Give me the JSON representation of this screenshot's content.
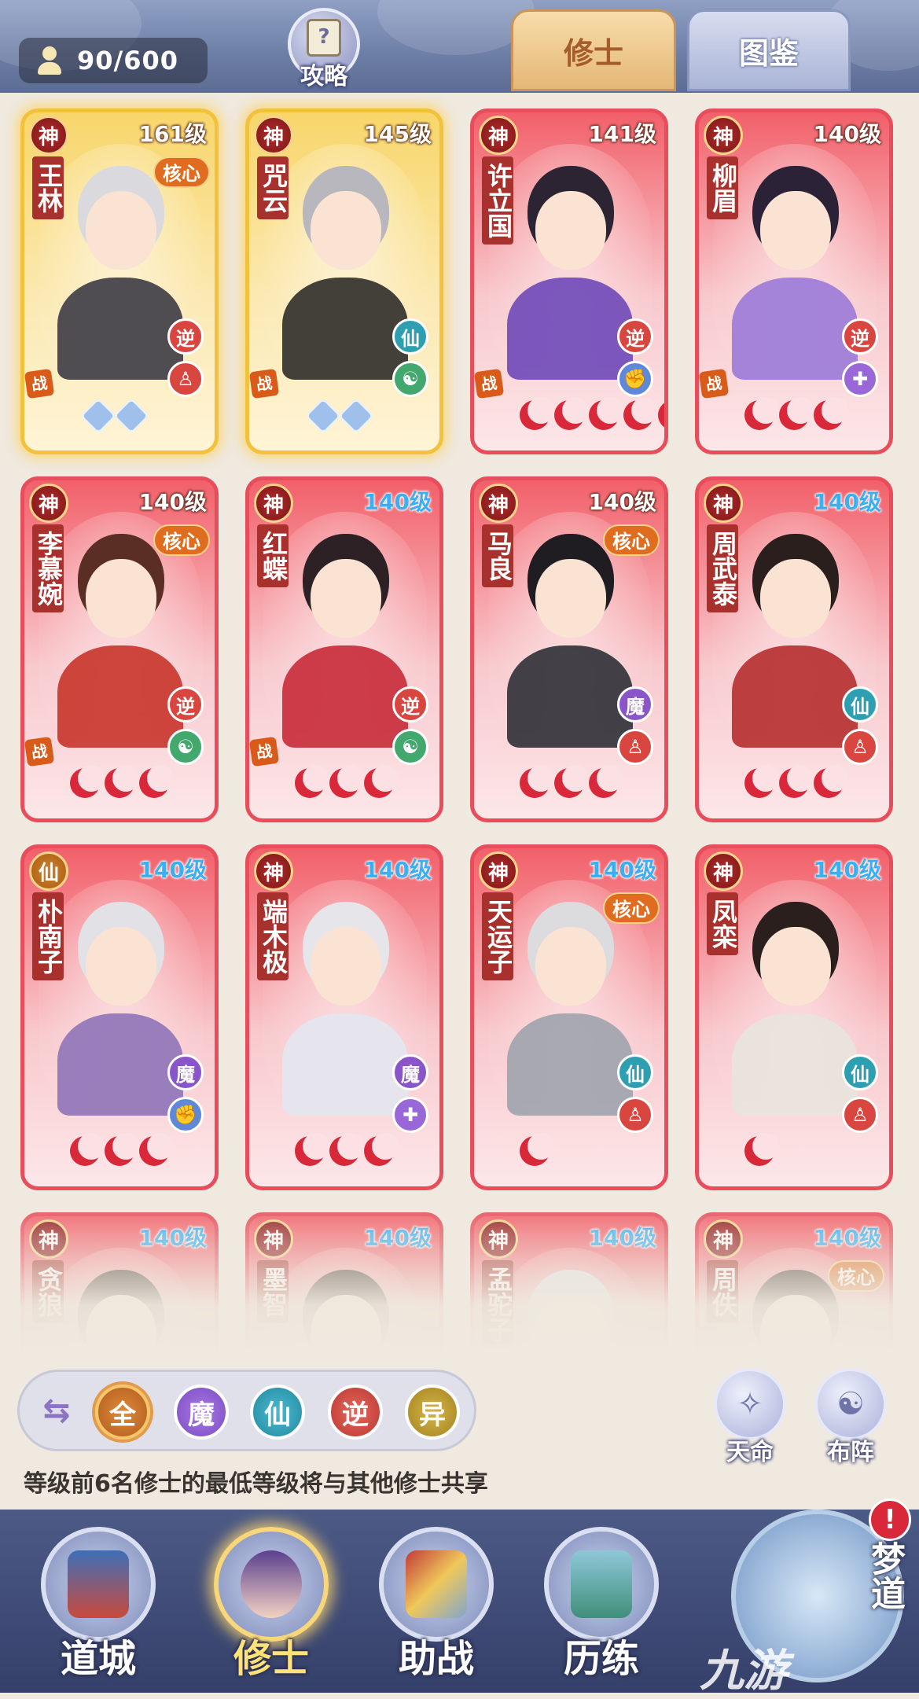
{
  "header": {
    "count": "90/600",
    "guide_label": "攻略",
    "tabs": [
      {
        "label": "修士",
        "active": true
      },
      {
        "label": "图鉴",
        "active": false
      }
    ]
  },
  "cards": [
    {
      "rank": "神",
      "level": "161级",
      "name": "王林",
      "core": "核心",
      "frame": "gold",
      "badges": [
        "逆",
        "体"
      ],
      "zhan": true,
      "moons": 0,
      "stars": 2
    },
    {
      "rank": "神",
      "level": "145级",
      "name": "咒云",
      "core": "",
      "frame": "gold",
      "badges": [
        "仙",
        "阴阳"
      ],
      "zhan": true,
      "moons": 0,
      "stars": 2
    },
    {
      "rank": "神",
      "level": "141级",
      "name": "许立国",
      "core": "",
      "frame": "red",
      "badges": [
        "逆",
        "臂"
      ],
      "zhan": true,
      "moons": 5,
      "stars": 0
    },
    {
      "rank": "神",
      "level": "140级",
      "name": "柳眉",
      "core": "",
      "frame": "red",
      "badges": [
        "逆",
        "疗"
      ],
      "zhan": true,
      "moons": 3,
      "stars": 0
    },
    {
      "rank": "神",
      "level": "140级",
      "name": "李慕婉",
      "core": "核心",
      "frame": "red",
      "badges": [
        "逆",
        "阴阳"
      ],
      "zhan": true,
      "moons": 3,
      "stars": 0
    },
    {
      "rank": "神",
      "level": "140级",
      "name": "红蝶",
      "core": "",
      "frame": "red",
      "badges": [
        "逆",
        "阴阳"
      ],
      "zhan": true,
      "moons": 3,
      "stars": 0,
      "blue_level": true
    },
    {
      "rank": "神",
      "level": "140级",
      "name": "马良",
      "core": "核心",
      "frame": "red",
      "badges": [
        "魔",
        "体"
      ],
      "zhan": false,
      "moons": 3,
      "stars": 0
    },
    {
      "rank": "神",
      "level": "140级",
      "name": "周武泰",
      "core": "",
      "frame": "red",
      "badges": [
        "仙",
        "体"
      ],
      "zhan": false,
      "moons": 3,
      "stars": 0,
      "blue_level": true
    },
    {
      "rank": "仙",
      "level": "140级",
      "name": "朴南子",
      "core": "",
      "frame": "red",
      "badges": [
        "魔",
        "臂"
      ],
      "zhan": false,
      "moons": 3,
      "stars": 0,
      "blue_level": true
    },
    {
      "rank": "神",
      "level": "140级",
      "name": "端木极",
      "core": "",
      "frame": "red",
      "badges": [
        "魔",
        "疗"
      ],
      "zhan": false,
      "moons": 3,
      "stars": 0,
      "blue_level": true
    },
    {
      "rank": "神",
      "level": "140级",
      "name": "天运子",
      "core": "核心",
      "frame": "red",
      "badges": [
        "仙",
        "体"
      ],
      "zhan": false,
      "moons": 1,
      "stars": 0,
      "blue_level": true
    },
    {
      "rank": "神",
      "level": "140级",
      "name": "凤栾",
      "core": "",
      "frame": "red",
      "badges": [
        "仙",
        "体"
      ],
      "zhan": false,
      "moons": 1,
      "stars": 0,
      "blue_level": true
    },
    {
      "rank": "神",
      "level": "140级",
      "name": "贪狼",
      "core": "",
      "frame": "red",
      "badges": [],
      "zhan": false,
      "moons": 0,
      "stars": 0,
      "blue_level": true
    },
    {
      "rank": "神",
      "level": "140级",
      "name": "墨智",
      "core": "",
      "frame": "red",
      "badges": [],
      "zhan": false,
      "moons": 0,
      "stars": 0,
      "blue_level": true
    },
    {
      "rank": "神",
      "level": "140级",
      "name": "孟驼子",
      "core": "",
      "frame": "red",
      "badges": [],
      "zhan": false,
      "moons": 0,
      "stars": 0,
      "blue_level": true
    },
    {
      "rank": "神",
      "level": "140级",
      "name": "周佚",
      "core": "核心",
      "frame": "red",
      "badges": [],
      "zhan": false,
      "moons": 0,
      "stars": 0,
      "blue_level": true
    }
  ],
  "filters": {
    "swap_icon": "⇆",
    "buttons": [
      "全",
      "魔",
      "仙",
      "逆",
      "异"
    ]
  },
  "side_buttons": {
    "fate": "天命",
    "formation": "布阵"
  },
  "tip": "等级前6名修士的最低等级将与其他修士共享",
  "bottom_nav": [
    {
      "label": "道城",
      "active": false
    },
    {
      "label": "修士",
      "active": true
    },
    {
      "label": "助战",
      "active": false
    },
    {
      "label": "历练",
      "active": false
    }
  ],
  "dream": {
    "label": "梦道",
    "alert": "!"
  },
  "watermark": "九游",
  "colors": {
    "accent": "#e74d5a",
    "gold": "#f2c23e",
    "nav": "#35406a"
  }
}
